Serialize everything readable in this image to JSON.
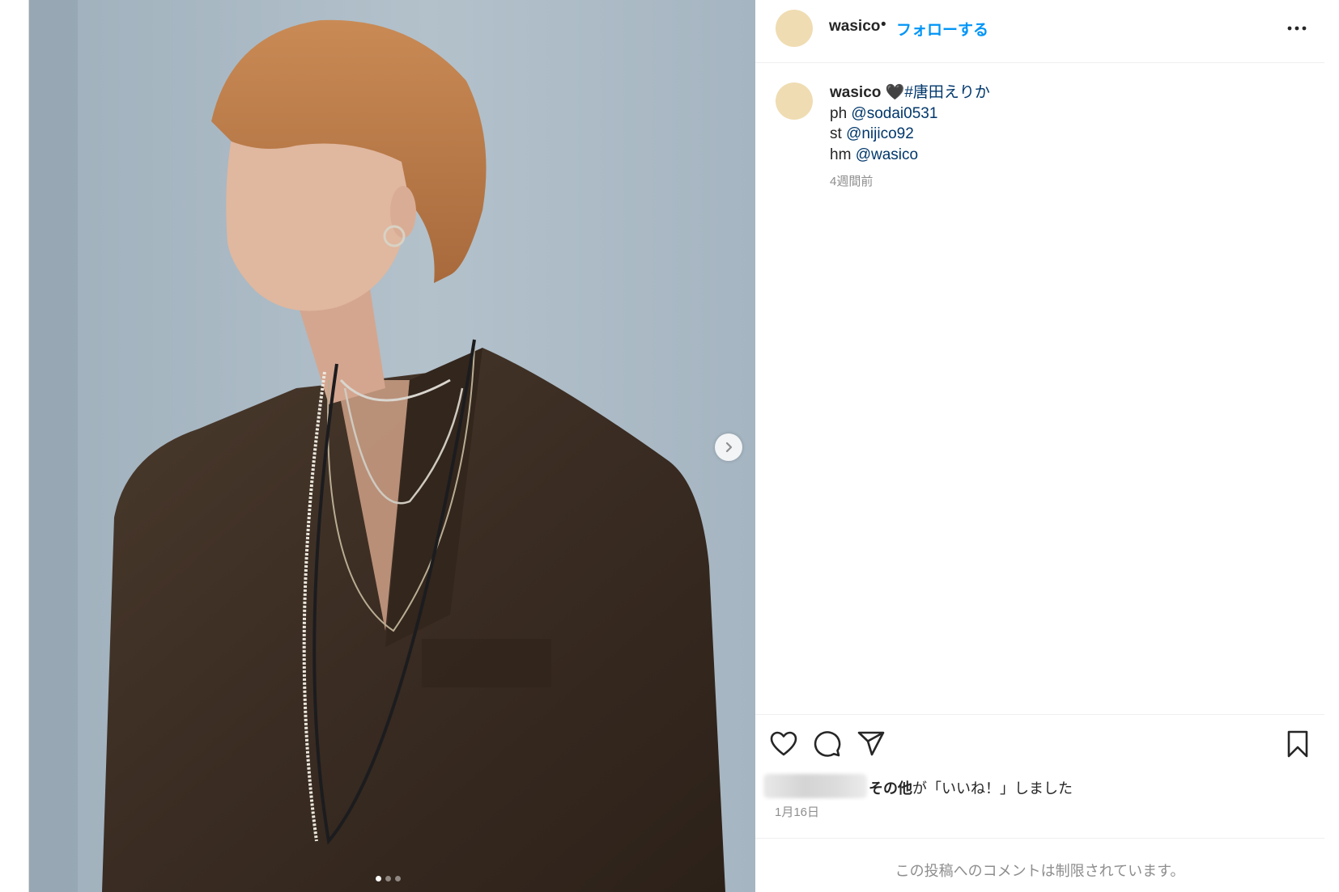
{
  "post": {
    "author": {
      "username": "wasico",
      "avatar_color": "#efdcb2"
    },
    "header": {
      "separator": "•",
      "follow_label": "フォローする",
      "more_icon": "more-horizontal-icon"
    },
    "caption": {
      "username": "wasico",
      "line1_emoji": "🖤",
      "line1_tag": "#唐田えりか",
      "credits": [
        {
          "prefix": "ph ",
          "mention": "@sodai0531"
        },
        {
          "prefix": "st ",
          "mention": "@nijico92"
        },
        {
          "prefix": "hm ",
          "mention": "@wasico"
        }
      ],
      "time": "4週間前"
    },
    "media": {
      "carousel_total": 3,
      "carousel_current": 1,
      "next_icon": "chevron-right-icon"
    },
    "actions": {
      "like_icon": "heart-icon",
      "comment_icon": "comment-icon",
      "share_icon": "paper-plane-icon",
      "save_icon": "bookmark-icon"
    },
    "likes": {
      "others_label": "その他",
      "suffix": "が「いいね！」しました"
    },
    "date": "1月16日",
    "comments_notice": "この投稿へのコメントは制限されています。",
    "colors": {
      "link": "#00376b",
      "follow": "#0095f6",
      "muted": "#8e8e8e"
    }
  }
}
